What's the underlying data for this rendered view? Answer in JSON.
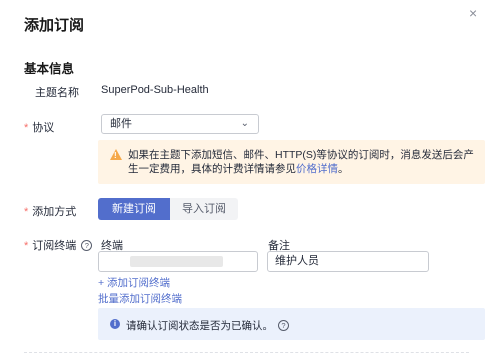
{
  "dialog": {
    "title": "添加订阅",
    "close_icon": "×"
  },
  "basic_info": {
    "section_title": "基本信息",
    "topic_name_label": "主题名称",
    "topic_name_value": "SuperPod-Sub-Health"
  },
  "protocol": {
    "required_mark": "*",
    "label": "协议",
    "selected": "邮件",
    "warning_text": "如果在主题下添加短信、邮件、HTTP(S)等协议的订阅时，消息发送后会产生一定费用，具体的计费详情请参见",
    "warning_link": "价格详情",
    "warning_end": "。"
  },
  "add_method": {
    "required_mark": "*",
    "label": "添加方式",
    "options": [
      "新建订阅",
      "导入订阅"
    ],
    "selected_index": 0
  },
  "endpoints": {
    "required_mark": "*",
    "label": "订阅终端",
    "help_icon": "?",
    "col_endpoint": "终端",
    "col_remark": "备注",
    "remark_value": "维护人员",
    "add_link": "+ 添加订阅终端",
    "batch_link": "批量添加订阅终端"
  },
  "notice": {
    "icon": "i",
    "text": "请确认订阅状态是否为已确认。",
    "help_icon": "?"
  },
  "colors": {
    "primary": "#526ecc",
    "required": "#f66f6a",
    "warning_bg": "#fff4e5",
    "warning_icon": "#f6a94a",
    "info_bg": "#ebf1fc"
  }
}
